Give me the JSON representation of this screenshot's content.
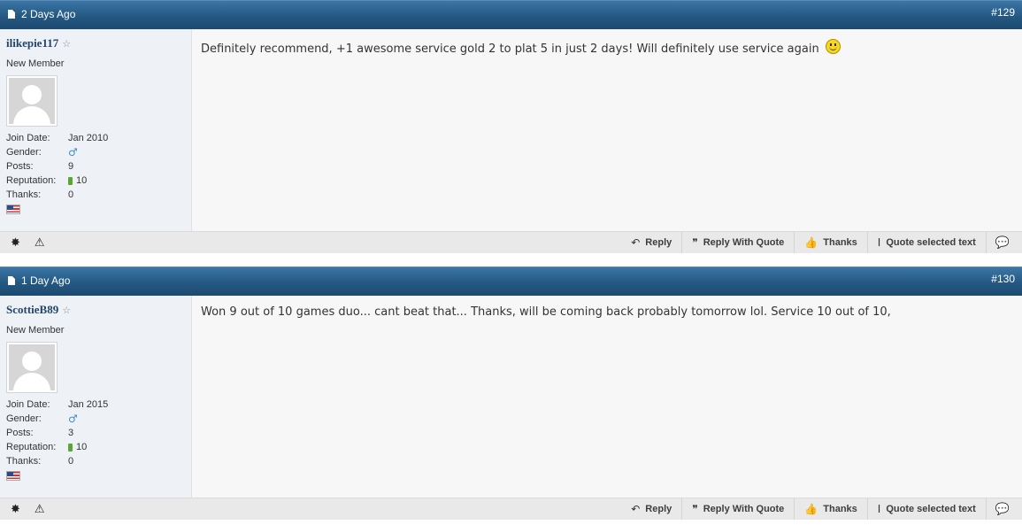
{
  "icons": {
    "doc": "document-icon",
    "star": "star-icon",
    "male": "male-gender-icon",
    "reputation": "reputation-bar-icon",
    "flag": "us-flag-icon",
    "smiley": "smiley-icon",
    "foot_left": [
      "star-burst-icon",
      "warning-triangle-icon"
    ]
  },
  "colors": {
    "header": "#245882",
    "username": "#23456b",
    "sidebar": "#eef2f6",
    "content": "#f7f7f7"
  },
  "labels": {
    "join_date": "Join Date:",
    "gender": "Gender:",
    "posts": "Posts:",
    "reputation": "Reputation:",
    "thanks": "Thanks:"
  },
  "buttons": {
    "reply": "Reply",
    "reply_quote": "Reply With Quote",
    "thanks": "Thanks",
    "quote_selected": "Quote selected text"
  },
  "posts": [
    {
      "date": "2 Days Ago",
      "number": "#129",
      "username": "ilikepie117",
      "usertitle": "New Member",
      "join_date": "Jan 2010",
      "posts": "9",
      "reputation": "10",
      "thanks": "0",
      "message": "Definitely recommend, +1 awesome service gold 2 to plat 5 in just 2 days! Will definitely use service again"
    },
    {
      "date": "1 Day Ago",
      "number": "#130",
      "username": "ScottieB89",
      "usertitle": "New Member",
      "join_date": "Jan 2015",
      "posts": "3",
      "reputation": "10",
      "thanks": "0",
      "message": "Won 9 out of 10 games duo... cant beat that... Thanks, will be coming back probably tomorrow lol. Service 10 out of 10,"
    }
  ]
}
